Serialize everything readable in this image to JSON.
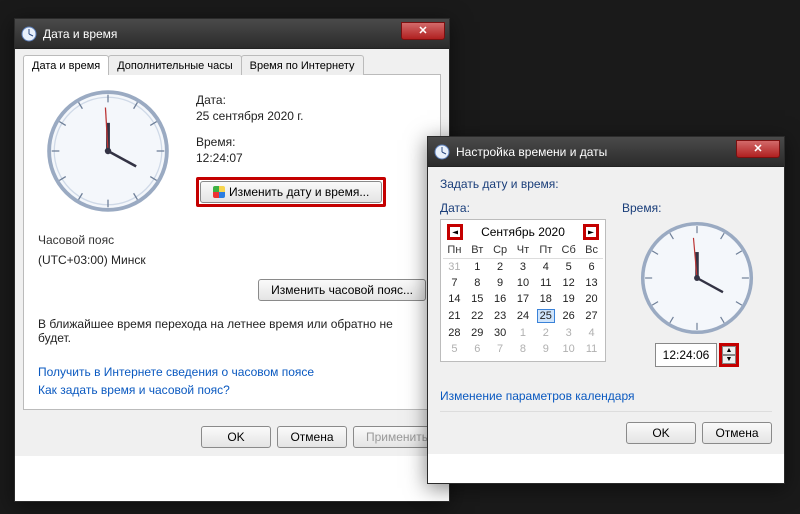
{
  "win1": {
    "title": "Дата и время",
    "tabs": [
      "Дата и время",
      "Дополнительные часы",
      "Время по Интернету"
    ],
    "date_label": "Дата:",
    "date_value": "25 сентября 2020 г.",
    "time_label": "Время:",
    "time_value": "12:24:07",
    "change_dt_btn": "Изменить дату и время...",
    "tz_label": "Часовой пояс",
    "tz_value": "(UTC+03:00) Минск",
    "change_tz_btn": "Изменить часовой пояс...",
    "dst_note": "В ближайшее время перехода на летнее время или обратно не будет.",
    "link_tzinfo": "Получить в Интернете сведения о часовом поясе",
    "link_howset": "Как задать время и часовой пояс?",
    "ok": "OK",
    "cancel": "Отмена",
    "apply": "Применить"
  },
  "win2": {
    "title": "Настройка времени и даты",
    "header": "Задать дату и время:",
    "date_label": "Дата:",
    "time_label": "Время:",
    "month_title": "Сентябрь 2020",
    "weekdays": [
      "Пн",
      "Вт",
      "Ср",
      "Чт",
      "Пт",
      "Сб",
      "Вс"
    ],
    "weeks": [
      [
        {
          "d": "31",
          "o": true
        },
        {
          "d": "1"
        },
        {
          "d": "2"
        },
        {
          "d": "3"
        },
        {
          "d": "4"
        },
        {
          "d": "5"
        },
        {
          "d": "6"
        }
      ],
      [
        {
          "d": "7"
        },
        {
          "d": "8"
        },
        {
          "d": "9"
        },
        {
          "d": "10"
        },
        {
          "d": "11"
        },
        {
          "d": "12"
        },
        {
          "d": "13"
        }
      ],
      [
        {
          "d": "14"
        },
        {
          "d": "15"
        },
        {
          "d": "16"
        },
        {
          "d": "17"
        },
        {
          "d": "18"
        },
        {
          "d": "19"
        },
        {
          "d": "20"
        }
      ],
      [
        {
          "d": "21"
        },
        {
          "d": "22"
        },
        {
          "d": "23"
        },
        {
          "d": "24"
        },
        {
          "d": "25",
          "sel": true
        },
        {
          "d": "26"
        },
        {
          "d": "27"
        }
      ],
      [
        {
          "d": "28"
        },
        {
          "d": "29"
        },
        {
          "d": "30"
        },
        {
          "d": "1",
          "o": true
        },
        {
          "d": "2",
          "o": true
        },
        {
          "d": "3",
          "o": true
        },
        {
          "d": "4",
          "o": true
        }
      ],
      [
        {
          "d": "5",
          "o": true
        },
        {
          "d": "6",
          "o": true
        },
        {
          "d": "7",
          "o": true
        },
        {
          "d": "8",
          "o": true
        },
        {
          "d": "9",
          "o": true
        },
        {
          "d": "10",
          "o": true
        },
        {
          "d": "11",
          "o": true
        }
      ]
    ],
    "time_value": "12:24:06",
    "link_calparams": "Изменение параметров календаря",
    "ok": "OK",
    "cancel": "Отмена"
  }
}
